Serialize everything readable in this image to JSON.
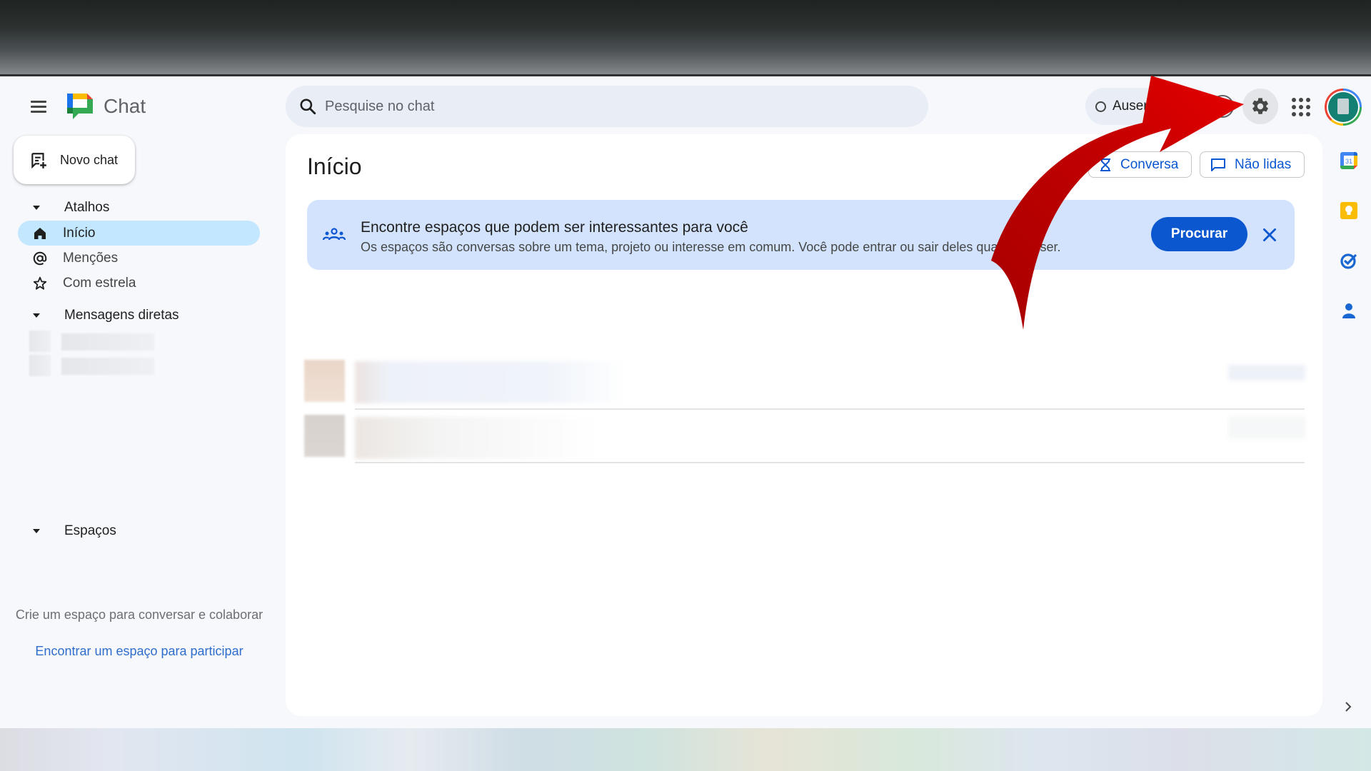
{
  "header": {
    "app_name": "Chat",
    "search_placeholder": "Pesquise no chat",
    "status_label": "Ausente",
    "settings_tooltip": "Configurações"
  },
  "sidebar": {
    "new_chat_label": "Novo chat",
    "shortcuts_label": "Atalhos",
    "shortcuts": [
      {
        "label": "Início",
        "icon": "home-icon",
        "active": true
      },
      {
        "label": "Menções",
        "icon": "at-icon",
        "active": false
      },
      {
        "label": "Com estrela",
        "icon": "star-icon",
        "active": false
      }
    ],
    "direct_messages_label": "Mensagens diretas",
    "spaces_label": "Espaços",
    "spaces_empty_text": "Crie um espaço para conversar e colaborar",
    "spaces_empty_link": "Encontrar um espaço para participar"
  },
  "main": {
    "title": "Início",
    "filters": [
      {
        "label": "Conversa",
        "icon": "hourglass-icon"
      },
      {
        "label": "Não lidas",
        "icon": "chat-bubble-icon"
      }
    ],
    "banner": {
      "title": "Encontre espaços que podem ser interessantes para você",
      "description": "Os espaços são conversas sobre um tema, projeto ou interesse em comum. Você pode entrar ou sair deles quando quiser.",
      "cta_label": "Procurar"
    }
  },
  "right_rail": [
    "calendar-icon",
    "keep-icon",
    "tasks-icon",
    "contacts-icon"
  ],
  "colors": {
    "accent": "#0b57d0",
    "active_nav": "#c2e7ff",
    "banner_bg": "#d3e3fd",
    "annotation_arrow": "#d90000"
  }
}
